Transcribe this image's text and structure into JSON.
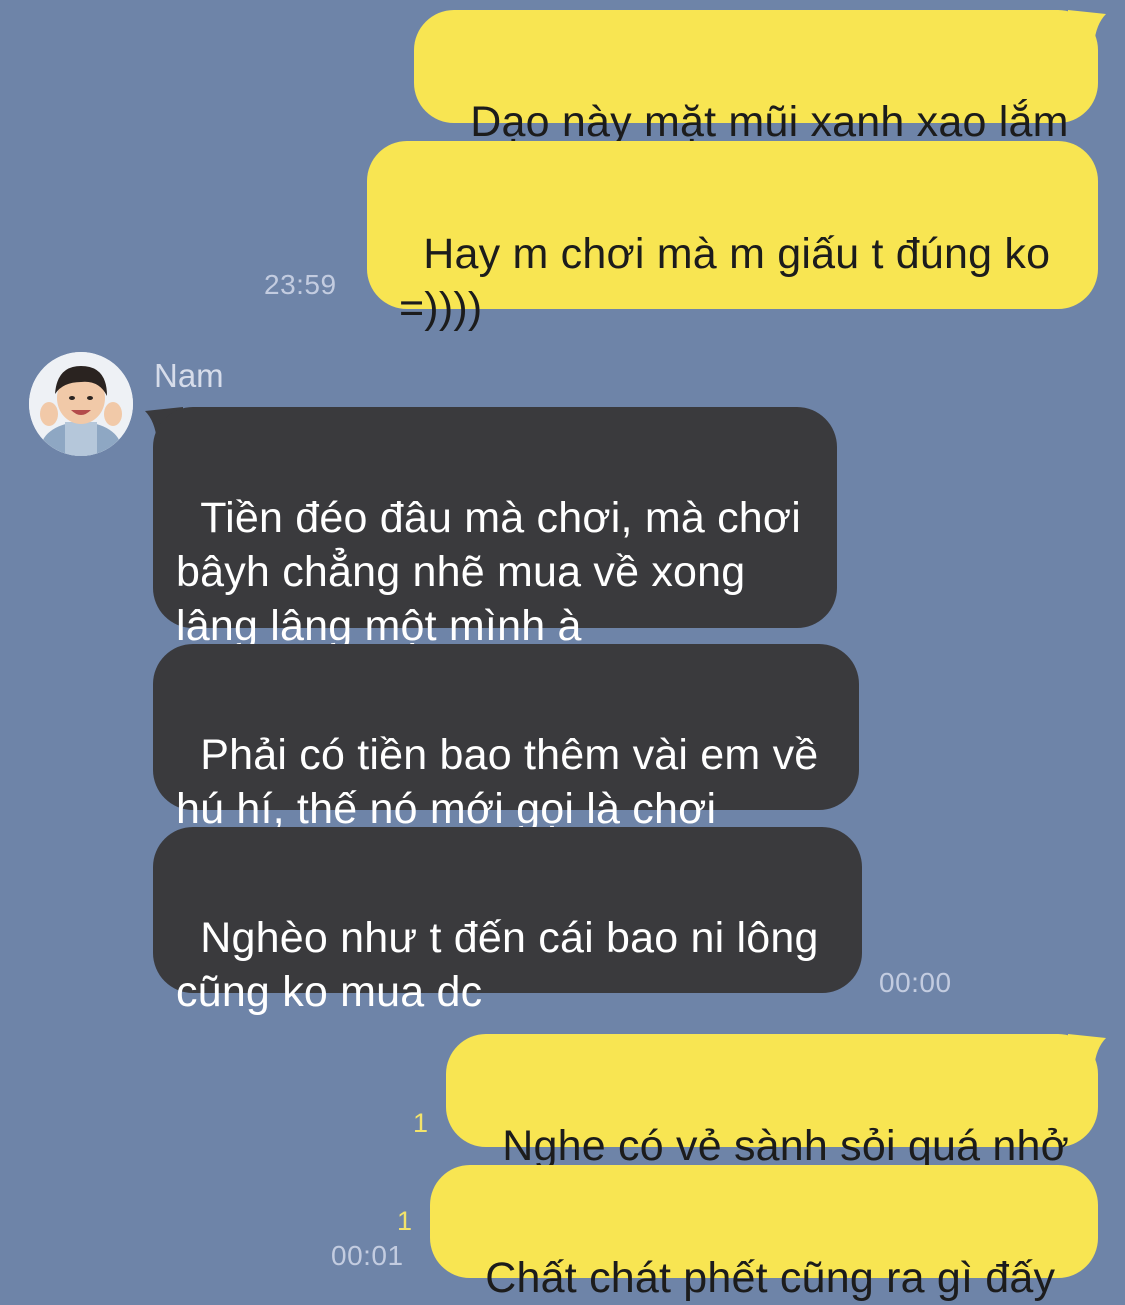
{
  "conversation": {
    "contact_name": "Nam",
    "messages": [
      {
        "sender": "me",
        "text": "Dạo này mặt mũi xanh xao lắm"
      },
      {
        "sender": "me",
        "text": "Hay m chơi mà m giấu t đúng ko\n=))))",
        "time": "23:59"
      },
      {
        "sender": "Nam",
        "text": "Tiền đéo đâu mà chơi, mà chơi\nbâyh chẳng nhẽ mua về xong\nlâng lâng một mình à"
      },
      {
        "sender": "Nam",
        "text": "Phải có tiền bao thêm vài em về\nhú hí, thế nó mới gọi là chơi"
      },
      {
        "sender": "Nam",
        "text": "Nghèo như t đến cái bao ni lông\ncũng ko mua dc",
        "time": "00:00"
      },
      {
        "sender": "me",
        "text": "Nghe có vẻ sành sỏi quá nhở",
        "read": "1"
      },
      {
        "sender": "me",
        "text": "Chất chát phết cũng ra gì đấy",
        "read": "1",
        "time": "00:01"
      }
    ]
  },
  "colors": {
    "background": "#6e84a8",
    "sent_bubble": "#f8e552",
    "received_bubble": "#3a3a3d",
    "read_receipt": "#f3e36a",
    "timestamp": "#c3cce0"
  },
  "icons": {
    "avatar": "child-photo-avatar"
  }
}
